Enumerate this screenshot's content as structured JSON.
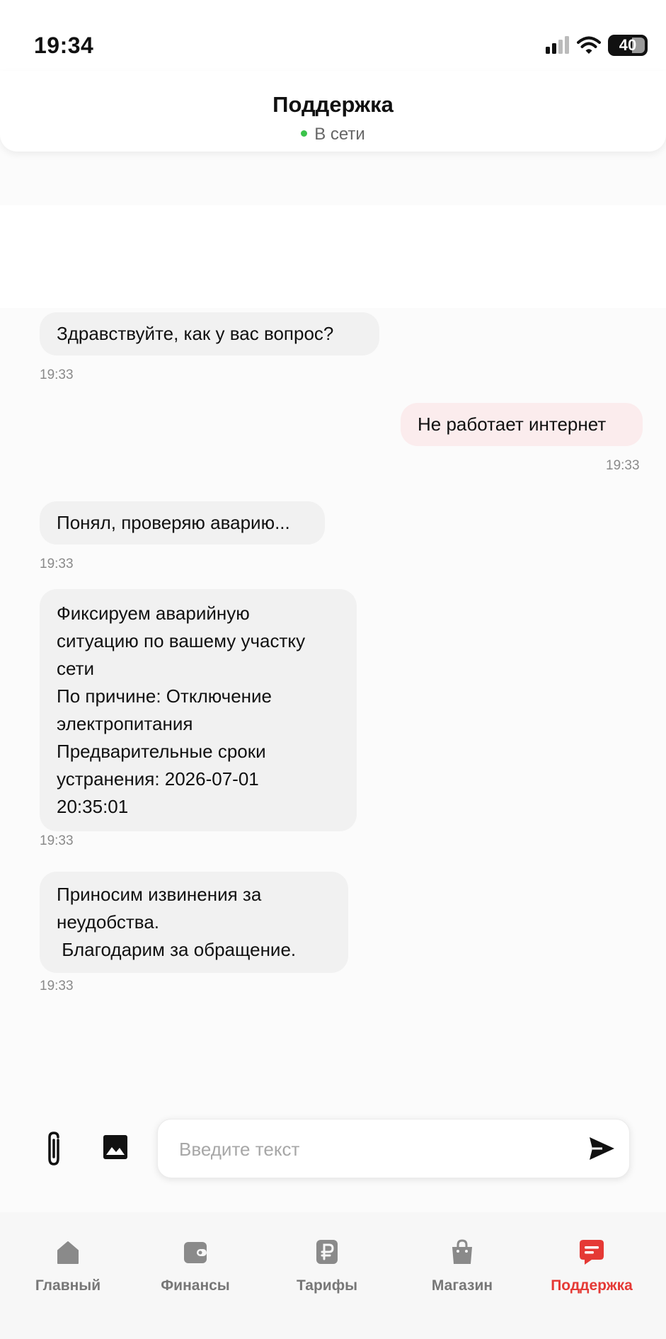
{
  "status_bar": {
    "time": "19:34",
    "battery": "40"
  },
  "header": {
    "title": "Поддержка",
    "status": "В сети"
  },
  "messages": [
    {
      "from": "support",
      "lines": [
        "Здравствуйте, как у вас вопрос?"
      ],
      "time": "19:33"
    },
    {
      "from": "user",
      "lines": [
        "Не работает интернет"
      ],
      "time": "19:33"
    },
    {
      "from": "support",
      "lines": [
        "Понял, проверяю аварию..."
      ],
      "time": "19:33"
    },
    {
      "from": "support",
      "lines": [
        "Фиксируем аварийную",
        "ситуацию по вашему участку",
        "сети",
        "По причине: Отключение",
        "электропитания",
        "Предварительные сроки",
        "устранения: 2026-07-01",
        "20:35:01"
      ],
      "time": "19:33"
    },
    {
      "from": "support",
      "lines": [
        "Приносим извинения за",
        "неудобства.",
        " Благодарим за обращение."
      ],
      "time": "19:33"
    }
  ],
  "input": {
    "placeholder": "Введите текст",
    "value": ""
  },
  "icons": {
    "attach": "paperclip-icon",
    "image": "image-icon",
    "send": "send-icon"
  },
  "nav": {
    "items": [
      {
        "label": "Главный",
        "icon": "home-icon"
      },
      {
        "label": "Финансы",
        "icon": "wallet-icon"
      },
      {
        "label": "Тарифы",
        "icon": "ruble-icon"
      },
      {
        "label": "Магазин",
        "icon": "bag-icon"
      },
      {
        "label": "Поддержка",
        "icon": "chat-icon",
        "active": true
      }
    ]
  },
  "colors": {
    "accent": "#e53935",
    "online": "#3ac34a",
    "incoming_bubble": "#f1f1f1",
    "outgoing_bubble": "#fbeced"
  }
}
